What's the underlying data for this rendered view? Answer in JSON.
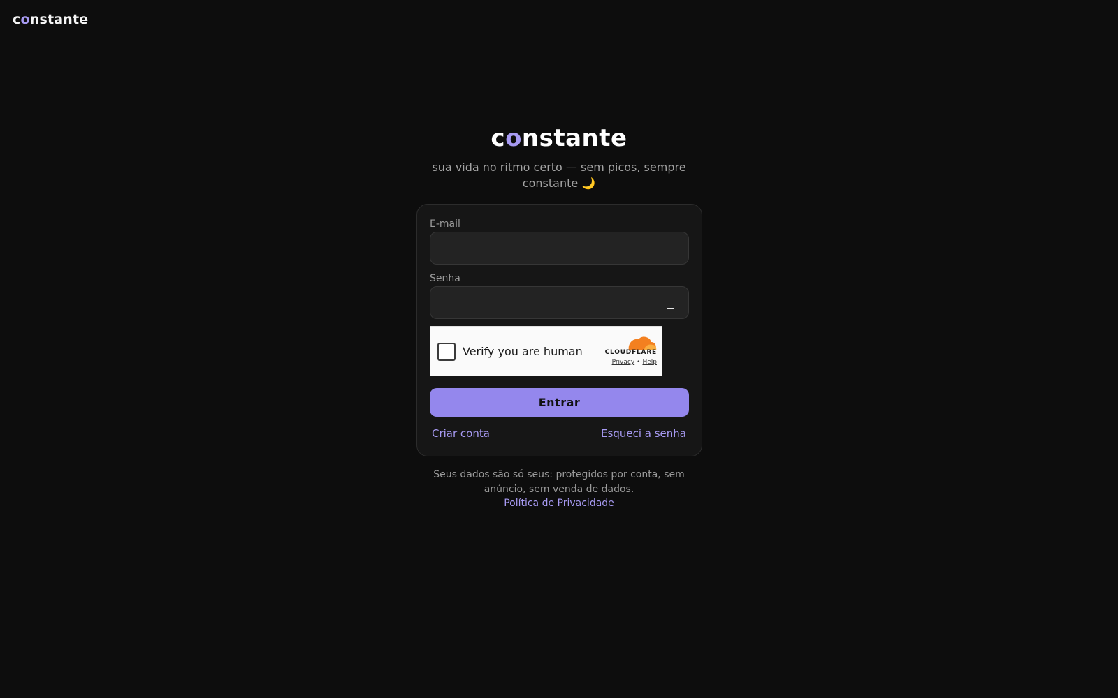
{
  "header": {
    "brand_prefix": "c",
    "brand_accent": "o",
    "brand_suffix": "nstante"
  },
  "hero": {
    "title_prefix": "c",
    "title_accent": "o",
    "title_suffix": "nstante",
    "tagline": "sua vida no ritmo certo — sem picos, sempre constante 🌙"
  },
  "login_form": {
    "email_label": "E-mail",
    "email_value": "",
    "email_placeholder": "",
    "password_label": "Senha",
    "password_value": "",
    "password_placeholder": "",
    "password_toggle_icon": "eye-icon",
    "captcha": {
      "label": "Verify you are human",
      "checked": false,
      "brand": "CLOUDFLARE",
      "privacy_link": "Privacy",
      "separator": "•",
      "help_link": "Help"
    },
    "submit_label": "Entrar",
    "create_account_link": "Criar conta",
    "forgot_password_link": "Esqueci a senha"
  },
  "footer": {
    "note": "Seus dados são só seus: protegidos por conta, sem anúncio, sem venda de dados.",
    "privacy_link": "Política de Privacidade"
  },
  "colors": {
    "background": "#0d0d0d",
    "card": "#161616",
    "accent": "#a79af2",
    "button": "#9487ed",
    "cloudflare_orange": "#f38020"
  }
}
